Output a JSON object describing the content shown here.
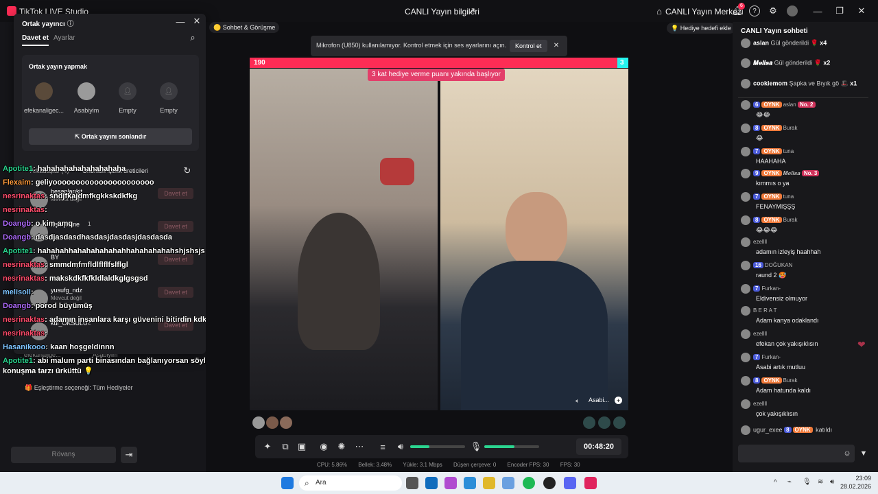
{
  "window": {
    "app_title": "TikTok LIVE Studio",
    "center_title": "CANLI Yayın bilgileri",
    "live_center": "CANLI Yayın Merkezi",
    "notif_count": "6"
  },
  "popup": {
    "title": "Ortak yayıncı",
    "tabs": [
      "Davet et",
      "Ayarlar"
    ],
    "section_title": "Ortak yayın yapmak",
    "slots": [
      {
        "name": "efekanaligec..."
      },
      {
        "name": "Asabiyim"
      },
      {
        "name": "Empty"
      },
      {
        "name": "Empty"
      }
    ],
    "end_button": "Ortak yayını sonlandır",
    "suggest_tab_a": "Arkadaşlar (4)",
    "suggest_tab_b": "Önerilen içerik üreticileri",
    "invite_label": "Davet et",
    "suggested": [
      {
        "name": "hesaplarıkit",
        "status": "Mevcut değil"
      },
      {
        "name": "Eşleştirme",
        "status": "1"
      },
      {
        "name": "BY",
        "status": "Mevcut değil"
      },
      {
        "name": "yusufg_ndz",
        "status": "Mevcut değil"
      },
      {
        "name": "kül_OKSULU",
        "status": "2"
      }
    ]
  },
  "behind_left": {
    "names": [
      "efekanalige...",
      "Asabiyim"
    ],
    "pairing_option": "Eşleştirme seçeneği: Tüm Hediyeler",
    "rematch_button": "Rövanş"
  },
  "chat_overlay": [
    {
      "user": "Apotite1",
      "color": "#2bd48f",
      "text": ": hahahahahahahahahaha"
    },
    {
      "user": "Flexaim",
      "color": "#ff9b3d",
      "text": ": geliyoooooooooooooooooooooo"
    },
    {
      "user": "nesrinaktas",
      "color": "#ff4d6d",
      "text": ": sndjfkajdmfkgkkskdkfkg"
    },
    {
      "user": "nesrinaktas",
      "color": "#ff4d6d",
      "text": ":"
    },
    {
      "user": "Doangb",
      "color": "#b06cff",
      "text": ": o kim amq"
    },
    {
      "user": "Doangb",
      "color": "#b06cff",
      "text": ": dasdjasdasdhasdasjdasdasjdasdasda"
    },
    {
      "user": "Apotite1",
      "color": "#2bd48f",
      "text": ": hahahahhahahahahahahhahahahahahshjshsjs"
    },
    {
      "user": "nesrinaktas",
      "color": "#ff4d6d",
      "text": ": smmdmfmfldlflflfslflgl"
    },
    {
      "user": "nesrinaktas",
      "color": "#ff4d6d",
      "text": ": makskdkfkfkldlaldkglgsgsd"
    },
    {
      "user": "melisoll",
      "color": "#7ec3ff",
      "text": ":"
    },
    {
      "user": "Doangb",
      "color": "#b06cff",
      "text": ": porod büyümüş"
    },
    {
      "user": "nesrinaktas",
      "color": "#ff4d6d",
      "text": ": adamın insanlara karşı güvenini bitirdin kdkfkglgl"
    },
    {
      "user": "nesrinaktas",
      "color": "#ff4d6d",
      "text": ":"
    },
    {
      "user": "Hasanikooo",
      "color": "#7ec3ff",
      "text": ": kaan hoşgeldinnn"
    },
    {
      "user": "Apotite1",
      "color": "#2bd48f",
      "text": ": abi malum parti binasından bağlanıyorsan söyle sıkma bizi be bu"
    },
    {
      "user": "",
      "color": "#ffffff",
      "text": "konuşma tarzı ürküttü 💡"
    }
  ],
  "stage": {
    "chip_left": "Sohbet & Görüşme",
    "chip_right": "Hediye hedefi ekle",
    "notice": "Mikrofon (U850) kullanılamıyor. Kontrol etmek için ses ayarlarını açın.",
    "notice_button": "Kontrol et",
    "score_left": "190",
    "score_right": "3",
    "banner": "3 kat hediye verme puanı yakında başlıyor",
    "right_name": "Asabi...",
    "timer": "00:48:20",
    "stats": [
      "CPU: 5.86%",
      "Bellek: 3.48%",
      "Yükle: 3.1 Mbps",
      "Düşen çerçeve: 0",
      "Encoder FPS: 30",
      "FPS: 30"
    ],
    "volume_level": 0.35,
    "mic_level": 0.55
  },
  "right_chat": {
    "title": "CANLI Yayın sohbeti",
    "gifts": [
      {
        "user": "aslan",
        "text": "Gül gönderildi",
        "count": "x4"
      },
      {
        "user": "𝑴𝒆𝒍𝒊𝒔𝒂",
        "text": "Gül gönderildi",
        "count": "x2"
      },
      {
        "user": "cookiemom",
        "text": "Şapka ve Bıyık gö",
        "count": "x1"
      }
    ],
    "messages": [
      {
        "lvl": "6",
        "fan": "OYNK",
        "user": "aslan",
        "extra": "No. 2",
        "text": "😂😂"
      },
      {
        "lvl": "8",
        "fan": "OYNK",
        "user": "Burak",
        "extra": "",
        "text": "😂"
      },
      {
        "lvl": "7",
        "fan": "OYNK",
        "user": "tuna",
        "extra": "",
        "text": "HAAHAHA"
      },
      {
        "lvl": "9",
        "fan": "OYNK",
        "user": "𝑴𝒆𝒍𝒊𝒔𝒂",
        "extra": "No. 3",
        "text": "kımmıs o ya"
      },
      {
        "lvl": "7",
        "fan": "OYNK",
        "user": "tuna",
        "extra": "",
        "text": "FENAYMIŞŞŞ"
      },
      {
        "lvl": "8",
        "fan": "OYNK",
        "user": "Burak",
        "extra": "",
        "text": "😂😂😂"
      },
      {
        "lvl": "",
        "fan": "",
        "user": "ezellll",
        "extra": "",
        "text": "adamın izleyiş haahhah"
      },
      {
        "lvl": "16",
        "fan": "",
        "user": "DOĞUKAN",
        "extra": "",
        "text": "raund 2 🥵"
      },
      {
        "lvl": "7",
        "fan": "",
        "user": "Furkan-",
        "extra": "",
        "text": "Eldivensiz olmuyor"
      },
      {
        "lvl": "",
        "fan": "",
        "user": "B E R A T",
        "extra": "",
        "text": "Adam kanya odaklandı"
      },
      {
        "lvl": "",
        "fan": "",
        "user": "ezellll",
        "extra": "",
        "text": "efekan çok yakışıklısın"
      },
      {
        "lvl": "7",
        "fan": "",
        "user": "Furkan-",
        "extra": "",
        "text": "Asabi artık mutluu"
      },
      {
        "lvl": "8",
        "fan": "OYNK",
        "user": "Burak",
        "extra": "",
        "text": "Adam hatunda kaldı"
      },
      {
        "lvl": "",
        "fan": "",
        "user": "ezellll",
        "extra": "",
        "text": "çok yakışıklısın"
      }
    ],
    "join_user": "ugur_exee",
    "join_lvl": "8",
    "join_fan": "OYNK",
    "join_text": "katıldı"
  },
  "taskbar": {
    "search": "Ara",
    "time": "23:09",
    "date": "28.02.2026"
  },
  "colors": {
    "accent_pink": "#fe2c55",
    "accent_cyan": "#25f4ee"
  }
}
